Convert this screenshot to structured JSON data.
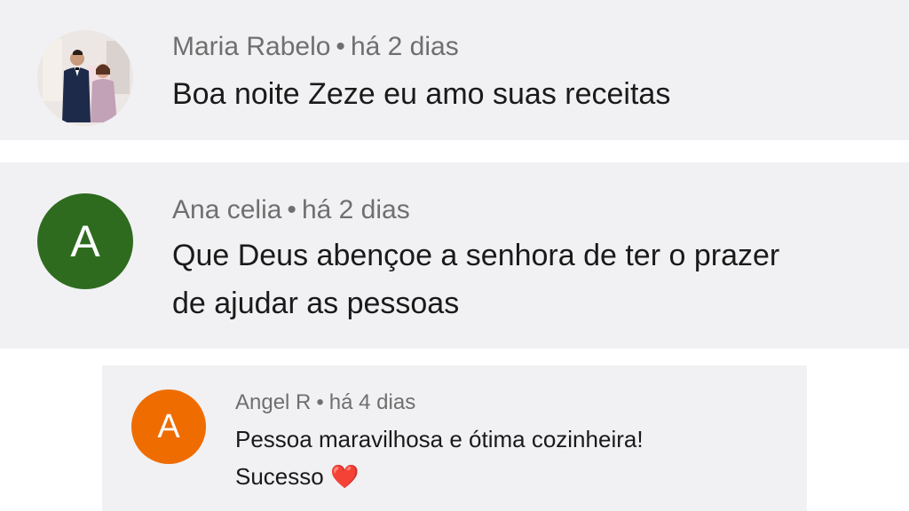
{
  "comments": [
    {
      "author": "Maria Rabelo",
      "separator": "•",
      "time": "há 2 dias",
      "avatar": {
        "type": "photo",
        "icon": "couple-photo-avatar"
      },
      "text_lines": [
        "Boa noite Zeze eu amo suas receitas"
      ]
    },
    {
      "author": "Ana celia",
      "separator": "•",
      "time": "há 2 dias",
      "avatar": {
        "type": "letter",
        "letter": "A",
        "color": "#2e6b1f"
      },
      "text_lines": [
        "Que Deus abençoe a senhora de ter o prazer",
        "de ajudar as pessoas"
      ]
    },
    {
      "author": "Angel R",
      "separator": "•",
      "time": "há 4 dias",
      "avatar": {
        "type": "letter",
        "letter": "A",
        "color": "#ef6c00"
      },
      "text_lines": [
        "Pessoa maravilhosa e ótima cozinheira!",
        "Sucesso"
      ],
      "emoji": "❤️",
      "emoji_icon": "red-heart-icon"
    }
  ]
}
